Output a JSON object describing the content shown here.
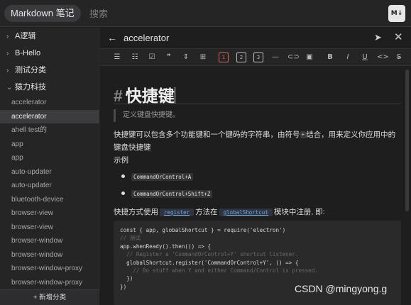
{
  "app": {
    "title": "Markdown 笔记",
    "search_placeholder": "搜索",
    "logo": "M↓"
  },
  "sidebar": {
    "categories": [
      {
        "label": "A逻辑",
        "chevron": "›"
      },
      {
        "label": "B-Hello",
        "chevron": "›"
      },
      {
        "label": "测试分类",
        "chevron": "›"
      },
      {
        "label": "猿力科技",
        "chevron": "⌄"
      }
    ],
    "notes": [
      "accelerator",
      "accelerator",
      "ahell test的",
      "app",
      "app",
      "auto-updater",
      "auto-updater",
      "bluetooth-device",
      "browser-view",
      "browser-view",
      "browser-window",
      "browser-window",
      "browser-window-proxy",
      "browser-window-proxy"
    ],
    "active_note_index": 1,
    "add_category_label": "+ 新增分类"
  },
  "editor": {
    "title": "accelerator"
  },
  "toolbar": {
    "items": [
      "☰",
      "☷",
      "☑",
      "❞",
      "⇕",
      "⊞",
      "1",
      "2",
      "3",
      "—",
      "⊂⊃",
      "▣",
      "B",
      "I",
      "U",
      "<>",
      "S"
    ]
  },
  "content": {
    "hash": "#",
    "heading": "快捷键",
    "quote": "定义键盘快捷键。",
    "para_before": "快捷键可以包含多个功能键和一个键码的字符串，由符号",
    "para_plus": "+",
    "para_after": "结合，用来定义你应用中的键盘快捷键",
    "example_label": "示例",
    "bullets": [
      "CommandOrControl+A",
      "CommandOrControl+Shift+Z"
    ],
    "api_before": "快捷方式使用",
    "api_code_1": "register",
    "api_middle": "方法在",
    "api_code_2": "globalShortcut",
    "api_after": "模块中注册, 即:",
    "code_lines": [
      "const { app, globalShortcut } = require('electron')",
      "// 测试",
      "app.whenReady().then(() => {",
      "  // Register a 'CommandOrControl+Y' shortcut listener.",
      "  globalShortcut.register('CommandOrControl+Y', () => {",
      "    // Do stuff when Y and either Command/Control is pressed.",
      "  })",
      "})"
    ]
  },
  "watermark": "CSDN @mingyong.g",
  "icons": {
    "back": "←",
    "send": "➤",
    "close": "✕"
  }
}
